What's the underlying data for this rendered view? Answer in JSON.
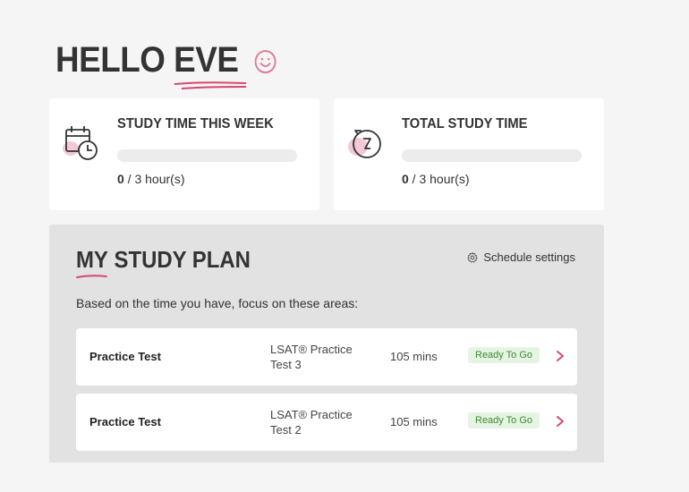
{
  "header": {
    "greeting_prefix": "HELLO",
    "greeting_name": "EVE",
    "smiley_icon": "smiley-icon"
  },
  "cards": {
    "week": {
      "title": "STUDY TIME THIS WEEK",
      "icon": "calendar-clock-icon",
      "progress_value": "0",
      "progress_suffix": " / 3 hour(s)",
      "progress_fraction": 0
    },
    "total": {
      "title": "TOTAL STUDY TIME",
      "icon": "stopwatch-icon",
      "progress_value": "0",
      "progress_suffix": " / 3 hour(s)",
      "progress_fraction": 0
    }
  },
  "plan": {
    "title_my": "MY",
    "title_rest": " STUDY PLAN",
    "schedule_label": "Schedule settings",
    "schedule_icon": "gear-icon",
    "subtitle": "Based on the time you have, focus on these areas:",
    "items": [
      {
        "type": "Practice Test",
        "name": "LSAT® Practice Test 3",
        "duration": "105 mins",
        "status": "Ready To Go"
      },
      {
        "type": "Practice Test",
        "name": "LSAT® Practice Test 2",
        "duration": "105 mins",
        "status": "Ready To Go"
      }
    ]
  },
  "colors": {
    "accent": "#d24a6f",
    "badge_bg": "#e6f4e4",
    "badge_text": "#3c8a2e",
    "panel_bg": "#e2e2e2",
    "page_bg": "#f5f5f5"
  }
}
